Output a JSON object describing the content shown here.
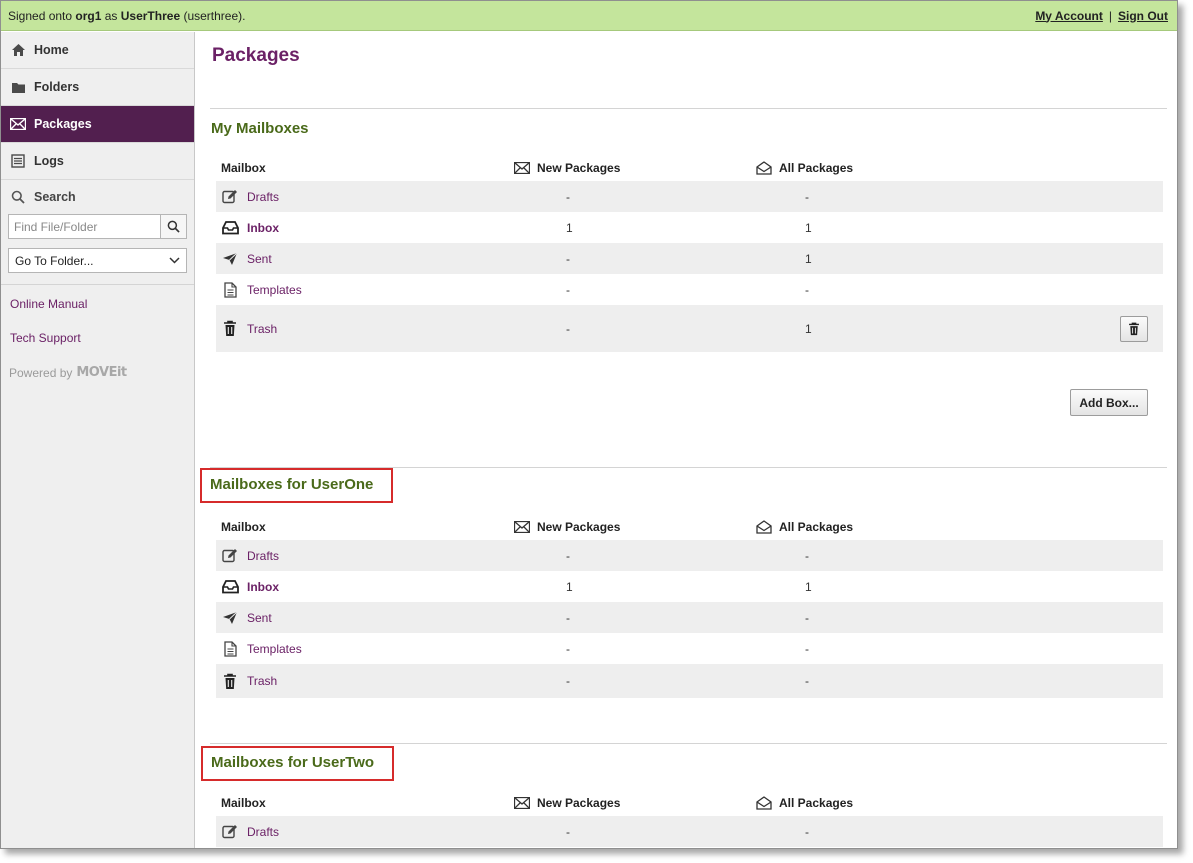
{
  "topbar": {
    "signed_prefix": "Signed onto ",
    "org": "org1",
    "as_word": " as ",
    "user": "UserThree",
    "username": " (userthree).",
    "my_account": "My Account",
    "separator": "|",
    "sign_out": "Sign Out"
  },
  "sidebar": {
    "nav": [
      {
        "label": "Home",
        "icon": "home-icon"
      },
      {
        "label": "Folders",
        "icon": "folder-icon"
      },
      {
        "label": "Packages",
        "icon": "envelope-icon",
        "active": true
      },
      {
        "label": "Logs",
        "icon": "logs-icon"
      }
    ],
    "search_label": "Search",
    "search_placeholder": "Find File/Folder",
    "goto_folder": "Go To Folder...",
    "online_manual": "Online Manual",
    "tech_support": "Tech Support",
    "powered_by": "Powered by",
    "powered_logo": "MOVEit"
  },
  "main": {
    "page_title": "Packages",
    "add_box": "Add Box...",
    "headers": {
      "mailbox": "Mailbox",
      "new_packages": "New Packages",
      "all_packages": "All Packages"
    },
    "sections": [
      {
        "title": "My Mailboxes",
        "rows": [
          {
            "name": "Drafts",
            "new": "-",
            "all": "-"
          },
          {
            "name": "Inbox",
            "new": "1",
            "all": "1"
          },
          {
            "name": "Sent",
            "new": "-",
            "all": "1"
          },
          {
            "name": "Templates",
            "new": "-",
            "all": "-"
          },
          {
            "name": "Trash",
            "new": "-",
            "all": "1"
          }
        ]
      },
      {
        "title": "Mailboxes for UserOne",
        "rows": [
          {
            "name": "Drafts",
            "new": "-",
            "all": "-"
          },
          {
            "name": "Inbox",
            "new": "1",
            "all": "1"
          },
          {
            "name": "Sent",
            "new": "-",
            "all": "-"
          },
          {
            "name": "Templates",
            "new": "-",
            "all": "-"
          },
          {
            "name": "Trash",
            "new": "-",
            "all": "-"
          }
        ]
      },
      {
        "title": "Mailboxes for UserTwo",
        "rows": [
          {
            "name": "Drafts",
            "new": "-",
            "all": "-"
          }
        ]
      }
    ]
  },
  "colors": {
    "topbar_bg": "#c4e59c",
    "nav_active_bg": "#521f4f",
    "link_purple": "#6b2166",
    "section_green": "#4a6a1a",
    "highlight_red": "#d62b2b"
  }
}
